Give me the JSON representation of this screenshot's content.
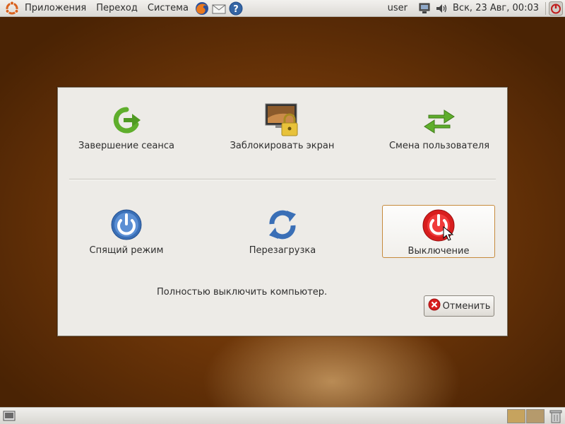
{
  "top_panel": {
    "menus": [
      "Приложения",
      "Переход",
      "Система"
    ],
    "launchers": [
      "firefox-icon",
      "mail-icon",
      "help-icon"
    ],
    "user": "user",
    "clock": "Вск, 23 Авг, 00:03",
    "tray": [
      "network-icon",
      "volume-icon"
    ]
  },
  "dialog": {
    "actions": [
      {
        "label": "Завершение сеанса",
        "icon": "logout-icon"
      },
      {
        "label": "Заблокировать экран",
        "icon": "lock-screen-icon"
      },
      {
        "label": "Смена пользователя",
        "icon": "switch-user-icon"
      },
      {
        "label": "Спящий режим",
        "icon": "sleep-icon"
      },
      {
        "label": "Перезагрузка",
        "icon": "restart-icon"
      },
      {
        "label": "Выключение",
        "icon": "shutdown-icon",
        "selected": true
      }
    ],
    "description": "Полностью выключить компьютер.",
    "cancel_label": "Отменить"
  },
  "colors": {
    "accent_orange": "#c68a3c",
    "dialog_bg": "#edebe7",
    "shutdown_red": "#d81e1e",
    "green": "#5fae2c",
    "blue": "#3a6fb6"
  }
}
